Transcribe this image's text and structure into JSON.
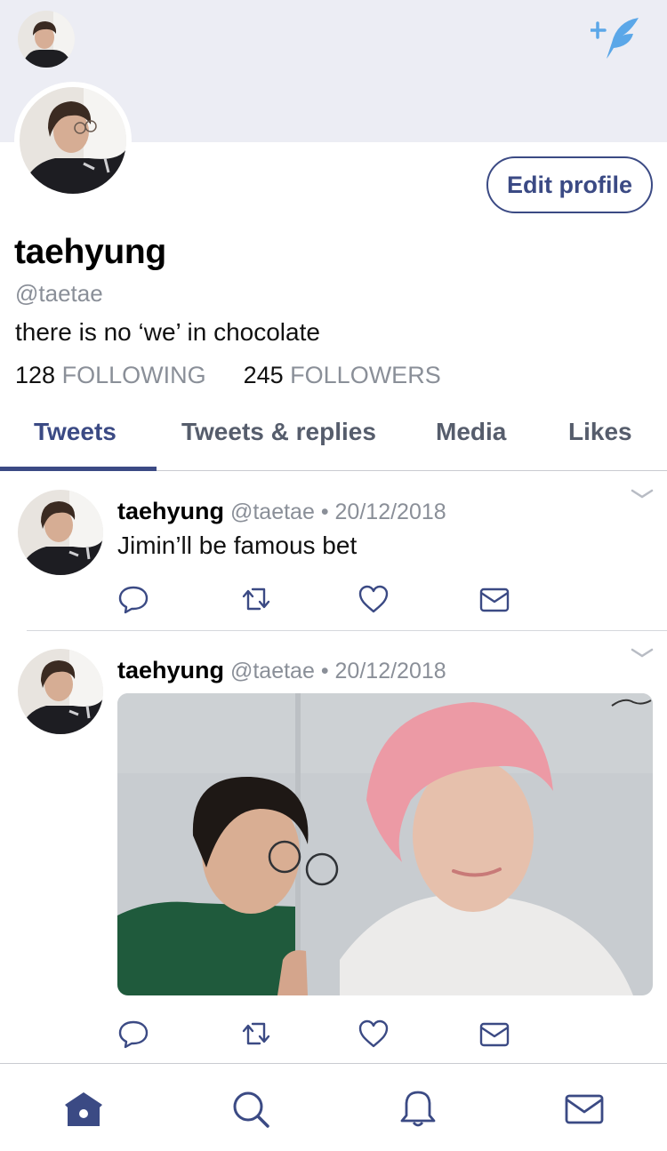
{
  "colors": {
    "accent": "#3b4a84",
    "secondary_text": "#8a8f98",
    "header_bg": "#ecedf4",
    "compose_blue": "#5ba7e8"
  },
  "icons": {
    "avatar": "profile-photo",
    "compose": "quill-sparkle-icon",
    "reply": "reply-icon",
    "retweet": "retweet-icon",
    "like": "heart-icon",
    "dm": "envelope-icon",
    "chevron": "chevron-down-icon",
    "home": "home-icon",
    "search": "search-icon",
    "notifications": "bell-icon",
    "messages": "envelope-icon"
  },
  "header": {
    "edit_label": "Edit profile"
  },
  "profile": {
    "display_name": "taehyung",
    "handle": "@taetae",
    "bio": "there is no ‘we’ in chocolate",
    "following_count": "128",
    "following_label": "FOLLOWING",
    "followers_count": "245",
    "followers_label": "FOLLOWERS"
  },
  "tabs": [
    {
      "label": "Tweets",
      "active": true
    },
    {
      "label": "Tweets & replies",
      "active": false
    },
    {
      "label": "Media",
      "active": false
    },
    {
      "label": "Likes",
      "active": false
    }
  ],
  "tweets": [
    {
      "name": "taehyung",
      "handle": "@taetae",
      "separator": "•",
      "date": "20/12/2018",
      "text": "Jimin’ll be famous bet",
      "has_photo": false
    },
    {
      "name": "taehyung",
      "handle": "@taetae",
      "separator": "•",
      "date": "20/12/2018",
      "text": "",
      "has_photo": true
    }
  ]
}
